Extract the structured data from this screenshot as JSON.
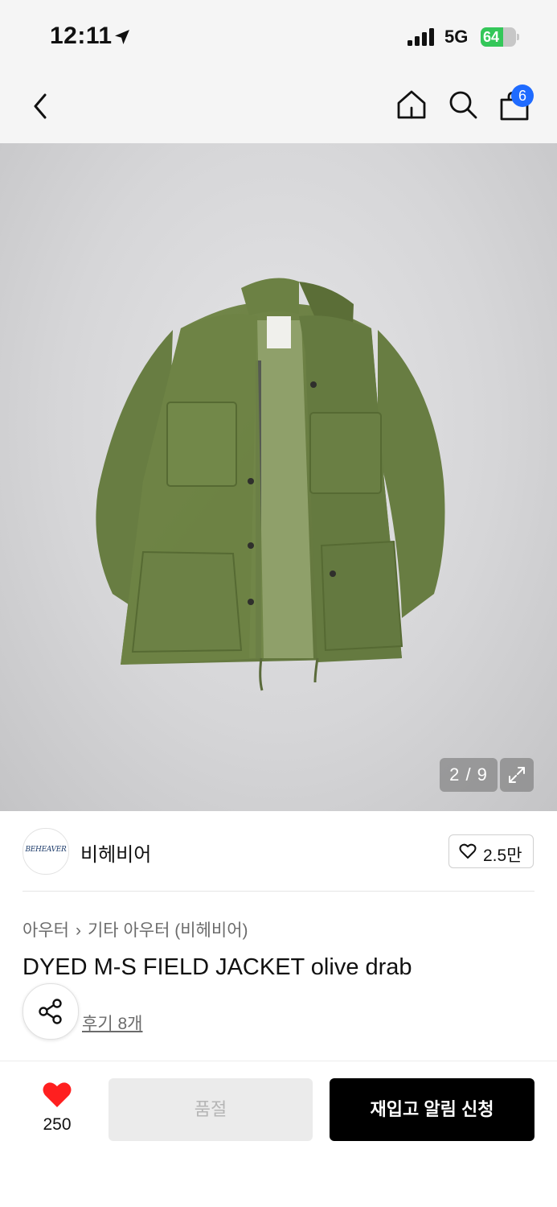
{
  "status_bar": {
    "time": "12:11",
    "network": "5G",
    "battery": "64",
    "battery_level": 0.64,
    "icons": [
      "location-arrow-icon",
      "signal-bars-icon",
      "battery-icon"
    ]
  },
  "nav": {
    "cart_count": "6",
    "icons": [
      "chevron-left-icon",
      "home-icon",
      "search-icon",
      "shopping-bag-icon"
    ]
  },
  "image": {
    "counter": "2 / 9",
    "icons": [
      "expand-icon"
    ]
  },
  "brand": {
    "logo_text": "BEHEAVER",
    "name": "비헤비어",
    "like_count": "2.5만",
    "icons": [
      "heart-outline-icon"
    ]
  },
  "product": {
    "breadcrumb": [
      "아우터",
      "기타 아우터 (비헤비어)"
    ],
    "title": "DYED M-S FIELD JACKET olive drab",
    "review_link": "후기 8개",
    "icons": [
      "share-icon",
      "chevron-right-icon"
    ]
  },
  "bottom_bar": {
    "wish_count": "250",
    "soldout_label": "품절",
    "restock_label": "재입고 알림 신청",
    "icons": [
      "heart-filled-icon"
    ]
  },
  "colors": {
    "accent_blue": "#1f6bff",
    "heart_red": "#ff1f1f",
    "battery_green": "#34c759",
    "jacket_olive": "#6c8144"
  }
}
